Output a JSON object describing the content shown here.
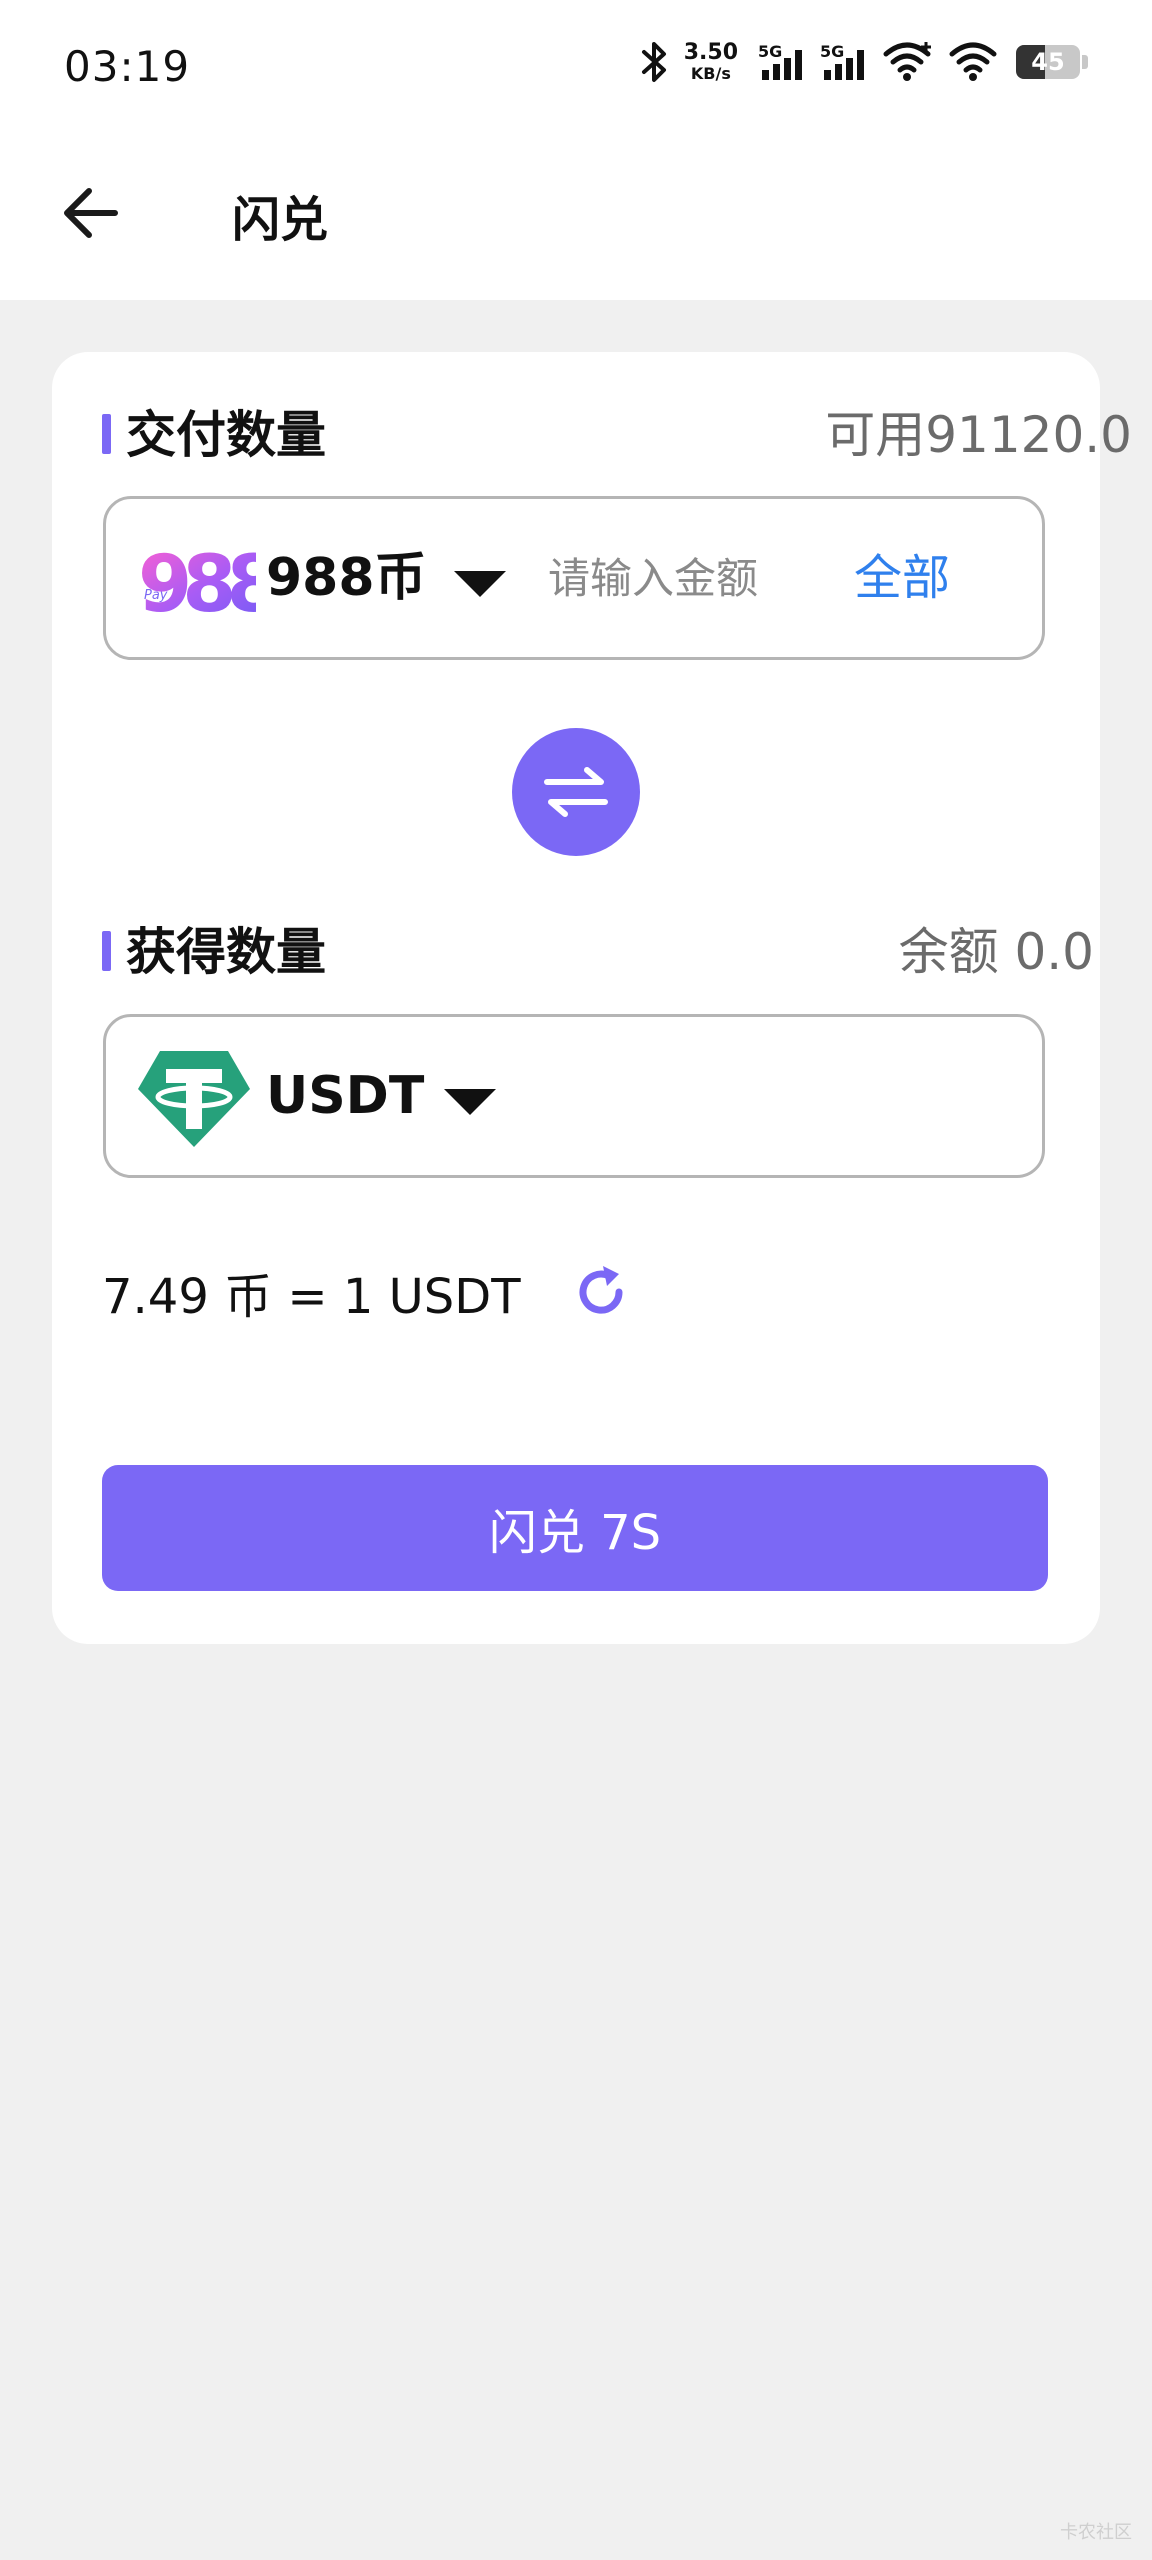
{
  "status_bar": {
    "time": "03:19",
    "net_speed_value": "3.50",
    "net_speed_unit": "KB/s",
    "sim1_tag": "5G",
    "sim2_tag": "5G",
    "battery_level": "45"
  },
  "header": {
    "title": "闪兑",
    "back_icon": "arrow-left-icon"
  },
  "pay_section": {
    "title": "交付数量",
    "available": "可用91120.0",
    "coin_name": "988币",
    "coin_logo_text": "988",
    "coin_logo_sub": "Pay",
    "amount_value": "",
    "amount_placeholder": "请输入金额",
    "all_label": "全部"
  },
  "receive_section": {
    "title": "获得数量",
    "balance": "余额 0.0",
    "coin_name": "USDT"
  },
  "rate": {
    "text": "7.49 币 = 1 USDT",
    "refresh_icon": "refresh-icon"
  },
  "submit": {
    "label": "闪兑 7S"
  },
  "watermark": "卡农社区",
  "colors": {
    "accent": "#7b68f5",
    "link": "#2f80ed",
    "tether": "#26a17b",
    "background": "#f0f0f0"
  }
}
